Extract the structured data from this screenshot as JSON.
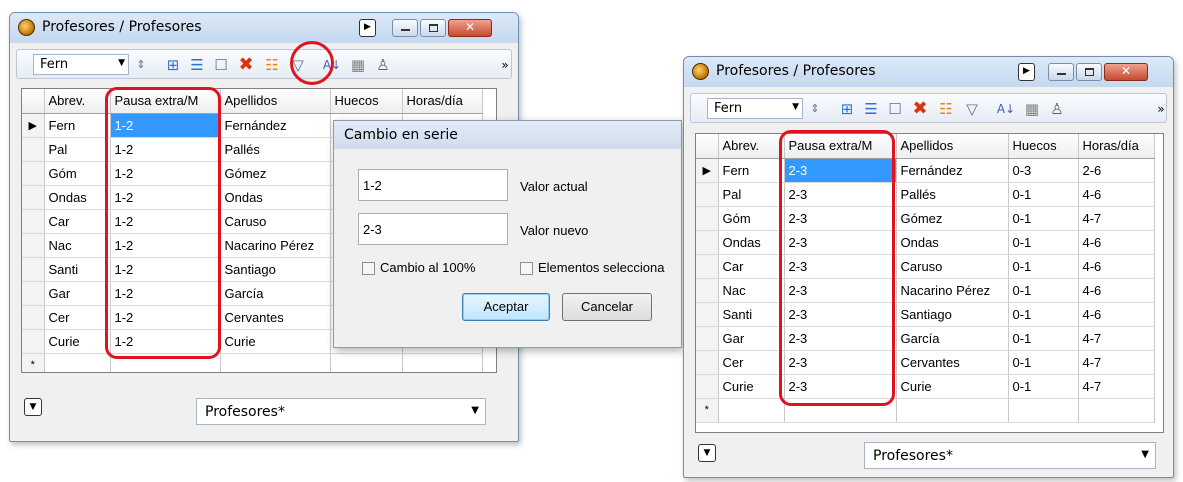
{
  "left_window": {
    "title": "Profesores / Profesores",
    "combo_value": "Fern",
    "columns": [
      "Abrev.",
      "Pausa extra/M",
      "Apellidos",
      "Huecos",
      "Horas/día"
    ],
    "rows": [
      {
        "abrev": "Fern",
        "pausa": "1-2",
        "apellidos": "Fernández",
        "huecos": "",
        "horas": ""
      },
      {
        "abrev": "Pal",
        "pausa": "1-2",
        "apellidos": "Pallés",
        "huecos": "",
        "horas": ""
      },
      {
        "abrev": "Góm",
        "pausa": "1-2",
        "apellidos": "Gómez",
        "huecos": "",
        "horas": ""
      },
      {
        "abrev": "Ondas",
        "pausa": "1-2",
        "apellidos": "Ondas",
        "huecos": "",
        "horas": ""
      },
      {
        "abrev": "Car",
        "pausa": "1-2",
        "apellidos": "Caruso",
        "huecos": "",
        "horas": ""
      },
      {
        "abrev": "Nac",
        "pausa": "1-2",
        "apellidos": "Nacarino Pérez",
        "huecos": "",
        "horas": ""
      },
      {
        "abrev": "Santi",
        "pausa": "1-2",
        "apellidos": "Santiago",
        "huecos": "",
        "horas": ""
      },
      {
        "abrev": "Gar",
        "pausa": "1-2",
        "apellidos": "García",
        "huecos": "",
        "horas": ""
      },
      {
        "abrev": "Cer",
        "pausa": "1-2",
        "apellidos": "Cervantes",
        "huecos": "",
        "horas": ""
      },
      {
        "abrev": "Curie",
        "pausa": "1-2",
        "apellidos": "Curie",
        "huecos": "",
        "horas": ""
      }
    ],
    "new_row_marker": "*",
    "current_row_marker": "▶",
    "bottom_dropdown": "Profesores*"
  },
  "dialog": {
    "title": "Cambio en serie",
    "current_value": "1-2",
    "current_label": "Valor actual",
    "new_value": "2-3",
    "new_label": "Valor nuevo",
    "check_100": "Cambio al 100%",
    "check_selected": "Elementos selecciona",
    "ok": "Aceptar",
    "cancel": "Cancelar"
  },
  "right_window": {
    "title": "Profesores / Profesores",
    "combo_value": "Fern",
    "columns": [
      "Abrev.",
      "Pausa extra/M",
      "Apellidos",
      "Huecos",
      "Horas/día"
    ],
    "rows": [
      {
        "abrev": "Fern",
        "pausa": "2-3",
        "apellidos": "Fernández",
        "huecos": "0-3",
        "horas": "2-6"
      },
      {
        "abrev": "Pal",
        "pausa": "2-3",
        "apellidos": "Pallés",
        "huecos": "0-1",
        "horas": "4-6"
      },
      {
        "abrev": "Góm",
        "pausa": "2-3",
        "apellidos": "Gómez",
        "huecos": "0-1",
        "horas": "4-7"
      },
      {
        "abrev": "Ondas",
        "pausa": "2-3",
        "apellidos": "Ondas",
        "huecos": "0-1",
        "horas": "4-6"
      },
      {
        "abrev": "Car",
        "pausa": "2-3",
        "apellidos": "Caruso",
        "huecos": "0-1",
        "horas": "4-6"
      },
      {
        "abrev": "Nac",
        "pausa": "2-3",
        "apellidos": "Nacarino Pérez",
        "huecos": "0-1",
        "horas": "4-6"
      },
      {
        "abrev": "Santi",
        "pausa": "2-3",
        "apellidos": "Santiago",
        "huecos": "0-1",
        "horas": "4-6"
      },
      {
        "abrev": "Gar",
        "pausa": "2-3",
        "apellidos": "García",
        "huecos": "0-1",
        "horas": "4-7"
      },
      {
        "abrev": "Cer",
        "pausa": "2-3",
        "apellidos": "Cervantes",
        "huecos": "0-1",
        "horas": "4-7"
      },
      {
        "abrev": "Curie",
        "pausa": "2-3",
        "apellidos": "Curie",
        "huecos": "0-1",
        "horas": "4-7"
      }
    ],
    "new_row_marker": "*",
    "current_row_marker": "▶",
    "bottom_dropdown": "Profesores*"
  },
  "toolbar_icons": [
    "combo-spin-icon",
    "move-icon",
    "list-icon",
    "new-record-icon",
    "delete-icon",
    "series-change-icon",
    "filter-icon",
    "sort-icon",
    "grid-view-icon",
    "people-icon",
    "more-icon"
  ],
  "colors": {
    "selection": "#3399ff",
    "highlight": "#e0141e",
    "close_button": "#c64a2e"
  }
}
